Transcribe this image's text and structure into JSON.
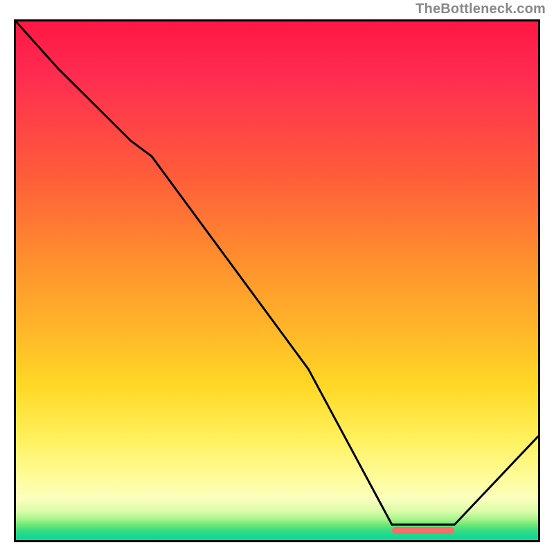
{
  "watermark": "TheBottleneck.com",
  "chart_data": {
    "type": "line",
    "title": "",
    "xlabel": "",
    "ylabel": "",
    "xlim": [
      0,
      100
    ],
    "ylim": [
      0,
      100
    ],
    "x": [
      0,
      8,
      22,
      26,
      56,
      72,
      84,
      100
    ],
    "values": [
      100,
      91,
      77,
      74,
      33,
      3,
      3,
      20
    ],
    "series": [
      {
        "name": "curve",
        "values": [
          100,
          91,
          77,
          74,
          33,
          3,
          3,
          20
        ]
      }
    ],
    "annotations": [
      {
        "type": "bar-marker",
        "x_start": 72,
        "x_end": 84,
        "y": 2,
        "color": "#ff6b6b"
      }
    ],
    "background_gradient_stops": [
      {
        "pct": 0,
        "color": "#ff1744"
      },
      {
        "pct": 45,
        "color": "#ff8c2e"
      },
      {
        "pct": 70,
        "color": "#ffd726"
      },
      {
        "pct": 92,
        "color": "#fbffbe"
      },
      {
        "pct": 100,
        "color": "#0fd59d"
      }
    ]
  }
}
